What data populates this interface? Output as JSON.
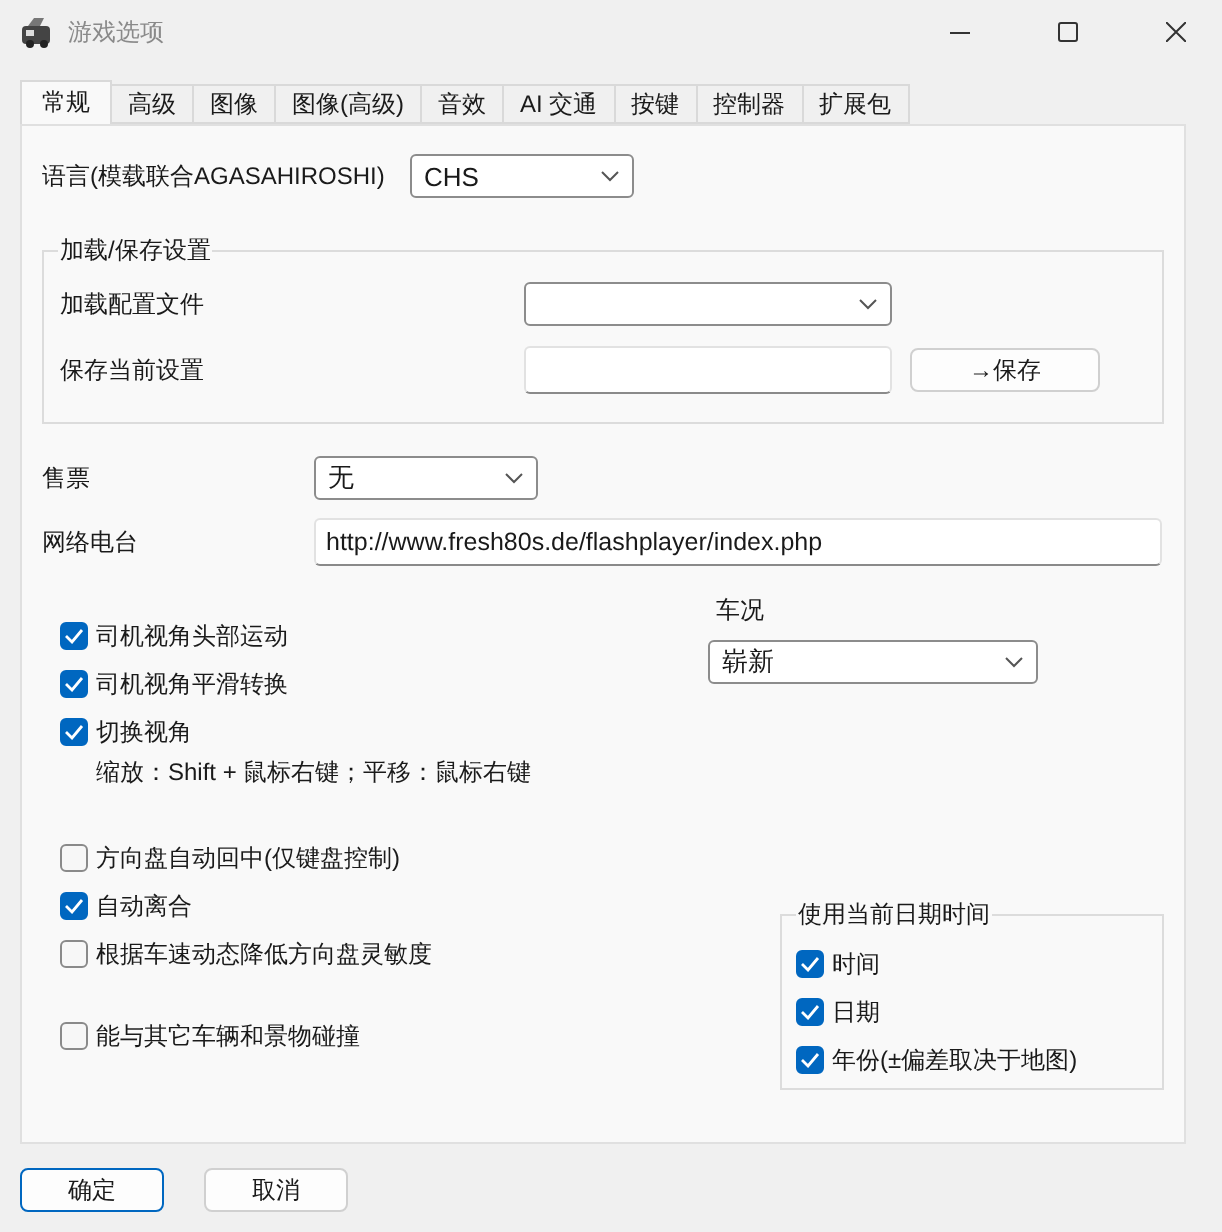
{
  "window": {
    "title": "游戏选项"
  },
  "tabs": [
    {
      "label": "常规",
      "selected": true
    },
    {
      "label": "高级",
      "selected": false
    },
    {
      "label": "图像",
      "selected": false
    },
    {
      "label": "图像(高级)",
      "selected": false
    },
    {
      "label": "音效",
      "selected": false
    },
    {
      "label": "AI 交通",
      "selected": false
    },
    {
      "label": "按键",
      "selected": false
    },
    {
      "label": "控制器",
      "selected": false
    },
    {
      "label": "扩展包",
      "selected": false
    }
  ],
  "language": {
    "label": "语言(模载联合AGASAHIROSHI)",
    "value": "CHS"
  },
  "load_save_group": {
    "title": "加载/保存设置",
    "load_label": "加载配置文件",
    "save_label": "保存当前设置",
    "save_button": "→保存"
  },
  "tickets": {
    "label": "售票",
    "value": "无"
  },
  "radio": {
    "label": "网络电台",
    "value": "http://www.fresh80s.de/flashplayer/index.php"
  },
  "checkbox_groups": [
    [
      {
        "label": "司机视角头部运动",
        "checked": true
      },
      {
        "label": "司机视角平滑转换",
        "checked": true
      },
      {
        "label": "切换视角",
        "checked": true,
        "hint": "缩放：Shift + 鼠标右键；平移：鼠标右键"
      }
    ],
    [
      {
        "label": "方向盘自动回中(仅键盘控制)",
        "checked": false
      },
      {
        "label": "自动离合",
        "checked": true
      },
      {
        "label": "根据车速动态降低方向盘灵敏度",
        "checked": false
      }
    ],
    [
      {
        "label": "能与其它车辆和景物碰撞",
        "checked": false
      }
    ]
  ],
  "vehicle_condition": {
    "label": "车况",
    "value": "崭新"
  },
  "date_group": {
    "title": "使用当前日期时间",
    "items": [
      {
        "label": "时间",
        "checked": true
      },
      {
        "label": "日期",
        "checked": true
      },
      {
        "label": "年份(±偏差取决于地图)",
        "checked": true
      }
    ]
  },
  "buttons": [
    {
      "label": "确定",
      "default": true
    },
    {
      "label": "取消",
      "default": false
    }
  ]
}
